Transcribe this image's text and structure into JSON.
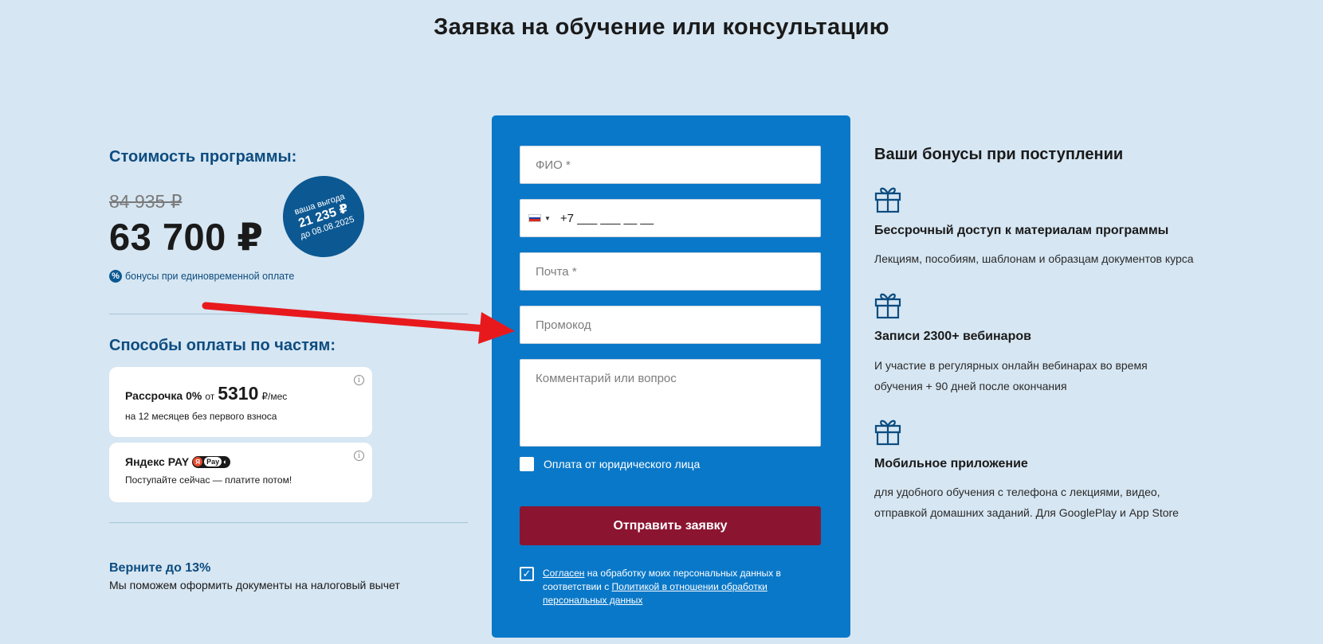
{
  "page_title": "Заявка на обучение или консультацию",
  "pricing": {
    "title": "Стоимость программы:",
    "old_price": "84 935 ₽",
    "new_price": "63 700 ₽",
    "badge_line1": "ваша выгода",
    "badge_amount": "21 235 ₽",
    "badge_line3": "до 08.08.2025",
    "bonus_note": "бонусы при единовременной оплате",
    "percent_symbol": "%"
  },
  "payment": {
    "title": "Способы оплаты по частям:",
    "installment": {
      "label": "Рассрочка 0%",
      "from": "от",
      "amount": "5310",
      "unit": "₽/мес",
      "subtitle": "на 12 месяцев без первого взноса"
    },
    "yandex": {
      "label": "Яндекс PAY",
      "badge_text": "Pay",
      "subtitle": "Поступайте сейчас — платите потом!"
    },
    "info_symbol": "i"
  },
  "refund": {
    "title": "Верните до 13%",
    "subtitle": "Мы поможем оформить документы на налоговый вычет"
  },
  "form": {
    "name_placeholder": "ФИО *",
    "phone_value": "+7 ___ ___ __ __",
    "email_placeholder": "Почта *",
    "promo_placeholder": "Промокод",
    "comment_placeholder": "Комментарий или вопрос",
    "legal_entity_label": "Оплата от юридического лица",
    "submit_label": "Отправить заявку",
    "consent": {
      "link1": "Согласен",
      "text1": " на обработку моих персональных данных в соответствии с ",
      "link2": "Политикой в отношении обработки персональных данных"
    },
    "check_mark": "✓"
  },
  "bonuses": {
    "title": "Ваши бонусы при поступлении",
    "items": [
      {
        "icon": "gift-icon",
        "title": "Бессрочный доступ к материалам программы",
        "desc": "Лекциям, пособиям, шаблонам и образцам документов курса"
      },
      {
        "icon": "gift-icon",
        "title": "Записи 2300+ вебинаров",
        "desc": "И участие в регулярных онлайн вебинарах во время обучения + 90 дней после окончания"
      },
      {
        "icon": "gift-icon",
        "title": "Мобильное приложение",
        "desc": "для удобного обучения с телефона с лекциями, видео, отправкой домашних заданий. Для GooglePlay и App Store"
      }
    ]
  },
  "colors": {
    "background": "#d6e6f2",
    "form_blue": "#0a78c8",
    "heading_blue": "#0d4c80",
    "submit": "#8b1531",
    "arrow": "#e8191d"
  }
}
